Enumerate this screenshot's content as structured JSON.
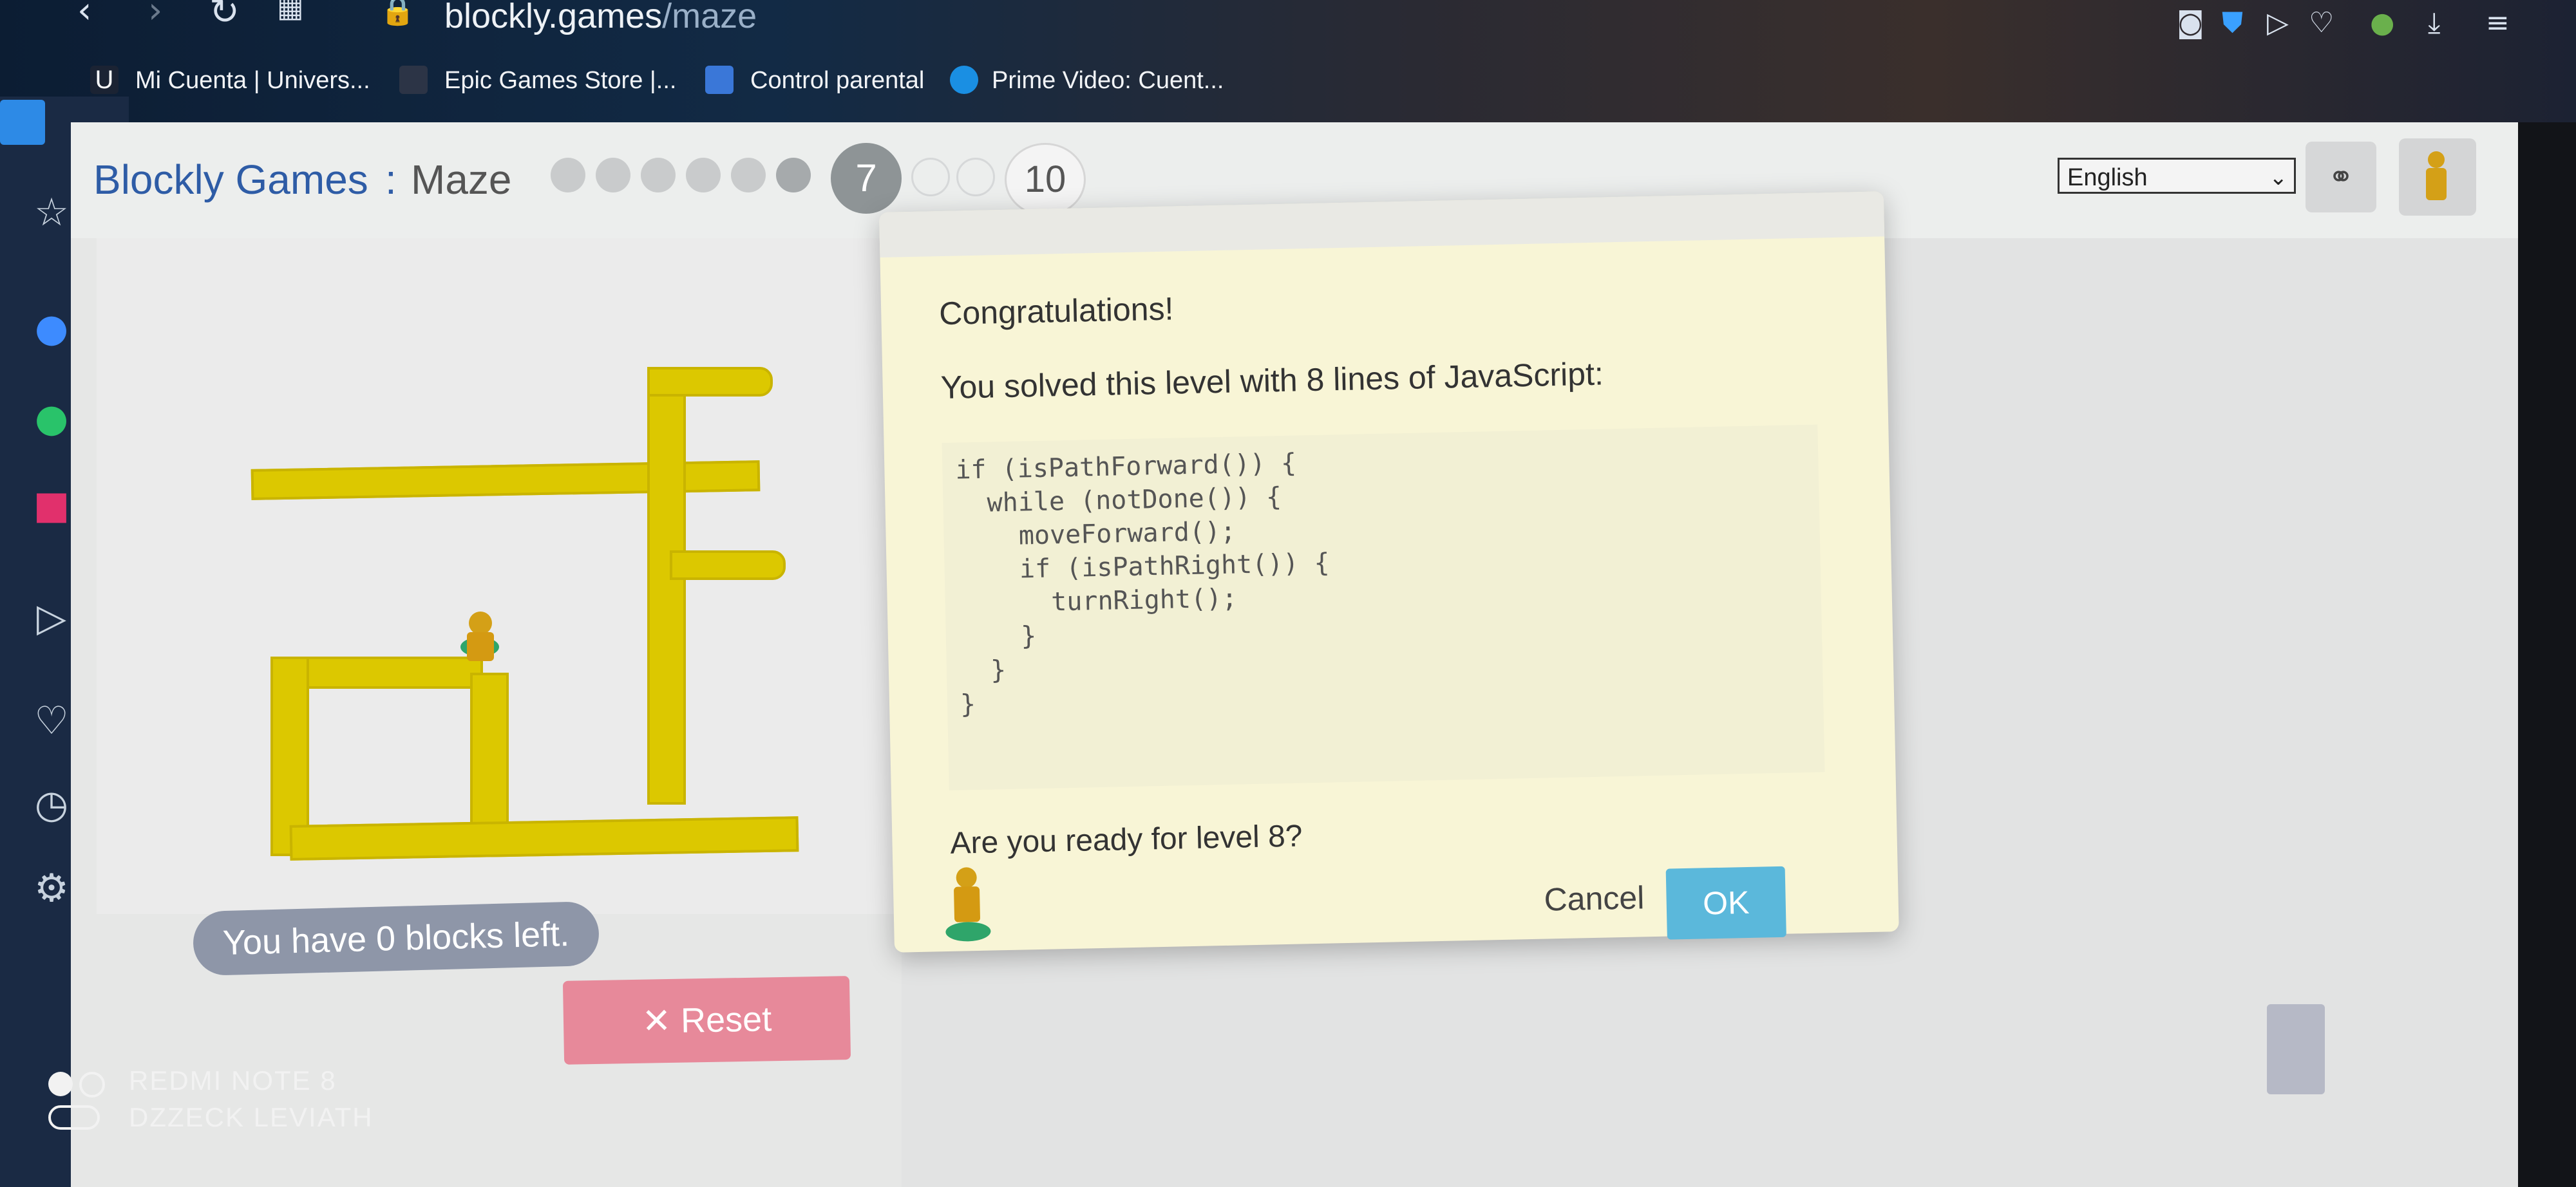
{
  "browser": {
    "url_host": "blockly.games",
    "url_path": "/maze",
    "bookmarks": [
      {
        "label": "Mi Cuenta | Univers...",
        "icon": "u-logo-icon",
        "color": "#ffffff"
      },
      {
        "label": "Epic Games Store |...",
        "icon": "epic-games-icon",
        "color": "#ffffff"
      },
      {
        "label": "Control parental",
        "icon": "parental-icon",
        "color": "#3a77d8"
      },
      {
        "label": "Prime Video: Cuent...",
        "icon": "prime-video-icon",
        "color": "#1a8fe3"
      }
    ]
  },
  "header": {
    "brand": "Blockly Games",
    "separator": ":",
    "game": "Maze",
    "current_level": "7",
    "last_level": "10",
    "language": "English"
  },
  "game": {
    "blocks_left": "You have 0 blocks left.",
    "reset_label": "Reset",
    "reset_icon": "✕"
  },
  "dialog": {
    "title": "Congratulations!",
    "message": "You solved this level with 8 lines of JavaScript:",
    "code": [
      "if (isPathForward()) {",
      "  while (notDone()) {",
      "    moveForward();",
      "    if (isPathRight()) {",
      "      turnRight();",
      "    }",
      "  }",
      "}"
    ],
    "question": "Are you ready for level 8?",
    "cancel_label": "Cancel",
    "ok_label": "OK"
  },
  "watermark": {
    "line1": "REDMI NOTE 8",
    "line2": "DZZECK LEVIATH"
  },
  "colors": {
    "accent_blue": "#2e5ca6",
    "ok_button": "#5bb8db",
    "reset_button": "#e7899a",
    "road": "#dcc800"
  }
}
